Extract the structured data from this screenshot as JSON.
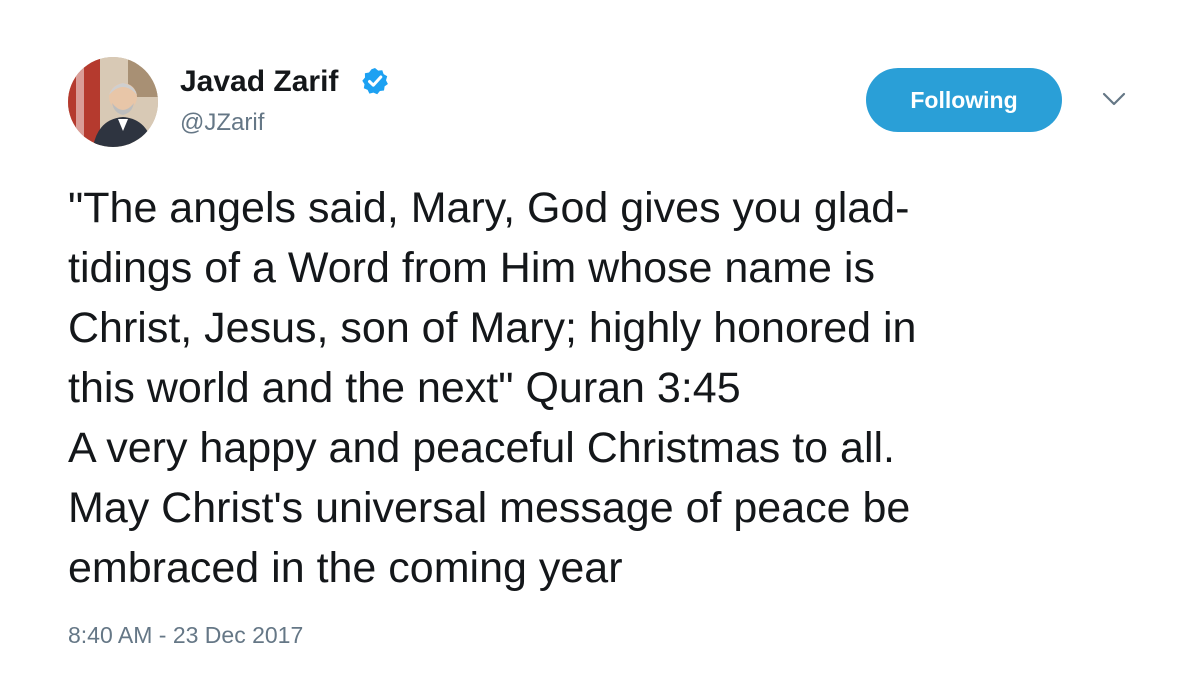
{
  "user": {
    "display_name": "Javad Zarif",
    "handle": "@JZarif",
    "verified": true,
    "avatar_icon": "profile-photo"
  },
  "actions": {
    "follow_label": "Following",
    "menu_icon": "chevron-down-icon"
  },
  "tweet": {
    "lines": [
      "\"The angels said, Mary, God gives you glad-",
      "tidings of a Word from Him whose name is",
      "Christ, Jesus, son of Mary; highly honored in",
      "this world and the next\" Quran 3:45",
      "A very happy and peaceful Christmas to all.",
      "May Christ's universal message of peace be",
      "embraced in the coming year"
    ],
    "timestamp": "8:40 AM - 23 Dec 2017"
  },
  "colors": {
    "accent": "#2a9fd7",
    "verified_badge": "#1da1f2",
    "secondary_text": "#657786",
    "primary_text": "#14171a"
  }
}
